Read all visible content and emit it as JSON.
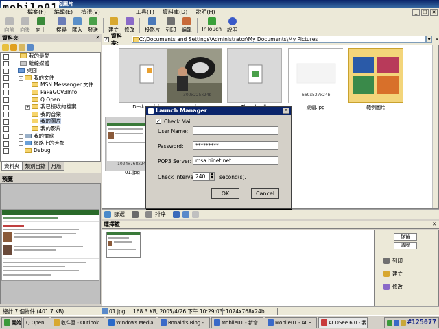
{
  "window": {
    "title": "ACDSee 6.0 - 我的圖片"
  },
  "logo": {
    "text": "mobile01"
  },
  "menu": [
    "檔案(F)",
    "編輯(E)",
    "檢視(V)",
    "工具(T)",
    "資料庫(D)",
    "說明(H)"
  ],
  "toolbar": {
    "buttons": [
      {
        "label": "向前",
        "icon": "back-icon",
        "enabled": false
      },
      {
        "label": "向後",
        "icon": "forward-icon",
        "enabled": false
      },
      {
        "label": "向上",
        "icon": "up-icon",
        "enabled": true
      },
      {
        "label": "搜尋",
        "icon": "search-icon",
        "enabled": true
      },
      {
        "label": "匯入",
        "icon": "import-icon",
        "enabled": true
      },
      {
        "label": "發送",
        "icon": "send-icon",
        "enabled": true
      },
      {
        "label": "建立",
        "icon": "create-icon",
        "enabled": true
      },
      {
        "label": "修改",
        "icon": "edit-icon",
        "enabled": true
      },
      {
        "label": "投影片",
        "icon": "slideshow-icon",
        "enabled": true
      },
      {
        "label": "列印",
        "icon": "print-icon",
        "enabled": true
      },
      {
        "label": "編輯",
        "icon": "editor-icon",
        "enabled": true
      },
      {
        "label": "InTouch",
        "icon": "intouch-icon",
        "enabled": true
      },
      {
        "label": "說明",
        "icon": "help-icon",
        "enabled": true
      }
    ]
  },
  "folders_panel": {
    "title": "資料夾",
    "items": [
      {
        "label": "我的最愛",
        "indent": 1,
        "expander": ""
      },
      {
        "label": "離線媒體",
        "indent": 1,
        "expander": ""
      },
      {
        "label": "桌面",
        "indent": 0,
        "expander": "-"
      },
      {
        "label": "我的文件",
        "indent": 1,
        "expander": "-"
      },
      {
        "label": "MSN Messenger 文件",
        "indent": 2,
        "expander": ""
      },
      {
        "label": "PaPaGOV3Info",
        "indent": 2,
        "expander": ""
      },
      {
        "label": "Q.Open",
        "indent": 2,
        "expander": ""
      },
      {
        "label": "我已接收的檔案",
        "indent": 2,
        "expander": "+"
      },
      {
        "label": "我的音樂",
        "indent": 2,
        "expander": ""
      },
      {
        "label": "我的圖片",
        "indent": 2,
        "expander": "",
        "selected": true
      },
      {
        "label": "我的影片",
        "indent": 2,
        "expander": ""
      },
      {
        "label": "我的電腦",
        "indent": 1,
        "expander": "+"
      },
      {
        "label": "網路上的芳鄰",
        "indent": 1,
        "expander": "+"
      },
      {
        "label": "Debug",
        "indent": 1,
        "expander": ""
      }
    ],
    "tabs": [
      "資料夾",
      "類別目錄",
      "月曆"
    ]
  },
  "preview_panel": {
    "title": "預覽"
  },
  "path_bar": {
    "label": "資料夾:",
    "path": "C:\\Documents and Settings\\Administrator\\My Documents\\My Pictures"
  },
  "files": [
    {
      "name": "Desktop.ini",
      "dims": ""
    },
    {
      "name": "me.jpg",
      "dims": "300x225x24b"
    },
    {
      "name": "Thumbs.db",
      "dims": ""
    },
    {
      "name": "桌帽.jpg",
      "dims": "669x527x24b"
    },
    {
      "name": "範例圖片",
      "dims": ""
    },
    {
      "name": "01.jpg",
      "dims": "1024x768x24b"
    }
  ],
  "view_bar": {
    "filter": "篩選",
    "sort": "排序"
  },
  "selection_pane": {
    "title": "選擇籃",
    "buttons": [
      "保留",
      "清除"
    ],
    "actions": [
      "列印",
      "建立",
      "修改"
    ]
  },
  "dialog": {
    "title": "Launch Manager",
    "check_mail_label": "Check Mail",
    "check_mail_checked": true,
    "user_name_label": "User Name:",
    "user_name": "",
    "password_label": "Password:",
    "password": "*********",
    "pop3_label": "POP3 Server:",
    "pop3": "msa.hinet.net",
    "interval_label": "Check Interval:",
    "interval": "240",
    "interval_unit": "second(s).",
    "ok": "OK",
    "cancel": "Cancel"
  },
  "status_bar": {
    "total": "總計 7 個物件 (401.7 KB)",
    "file": "01.jpg",
    "info": "168.3 KB, 2005/4/26 下午 10:29:03*",
    "dims": "1024x768x24b"
  },
  "taskbar": {
    "start": "開始",
    "tasks": [
      "Q.Open",
      "收件匣 - Outlook...",
      "Windows Media...",
      "Ronald's Blog -...",
      "Mobile01 - 新增...",
      "Mobile01 - ACE...",
      "ACDSee 6.0 - 我..."
    ],
    "clock": "#125077"
  },
  "colors": {
    "titlebar": "#0a246a",
    "face": "#d4d0c8",
    "selection": "#c7d4ea"
  }
}
